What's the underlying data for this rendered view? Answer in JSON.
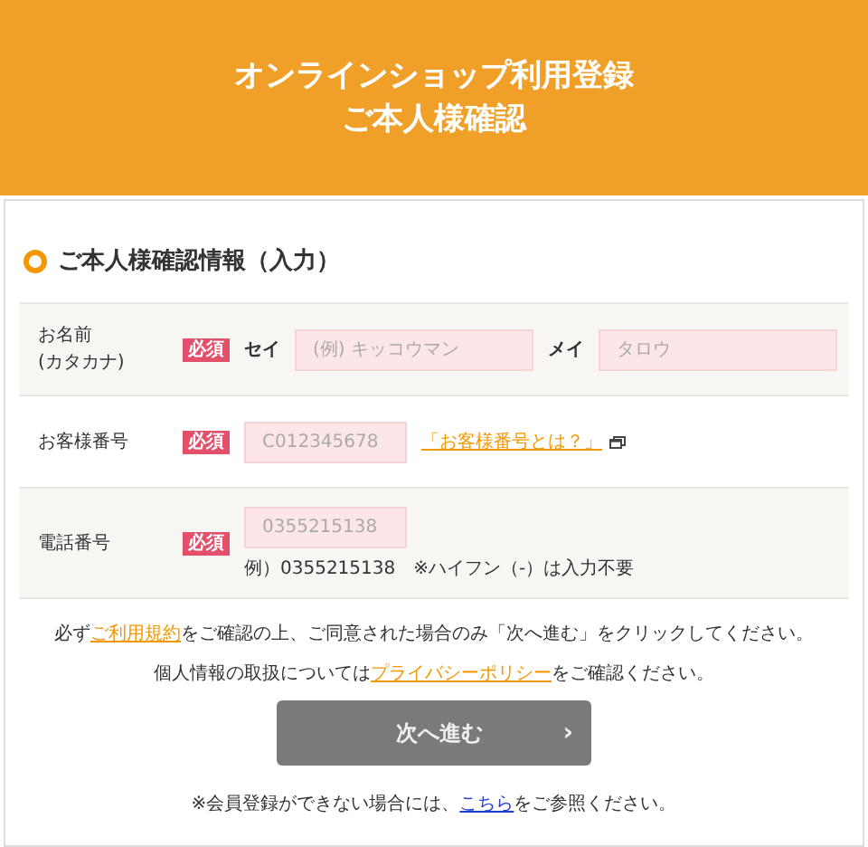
{
  "header": {
    "title_lines": [
      "オンラインショップ利用登録",
      "ご本人様確認"
    ]
  },
  "section": {
    "title": "ご本人様確認情報（入力）"
  },
  "rows": [
    {
      "label_lines": [
        "お名前",
        "(カタカナ)"
      ],
      "required": "必須",
      "kind": "name",
      "fields": [
        {
          "label": "セイ",
          "placeholder": "(例) キッコウマン"
        },
        {
          "label": "メイ",
          "placeholder": "タロウ"
        }
      ]
    },
    {
      "label_lines": [
        "お客様番号"
      ],
      "required": "必須",
      "kind": "link",
      "fields": [
        {
          "placeholder": "C012345678"
        }
      ],
      "link": "「お客様番号とは？」"
    },
    {
      "label_lines": [
        "電話番号"
      ],
      "required": "必須",
      "kind": "note",
      "fields": [
        {
          "placeholder": "0355215138"
        }
      ],
      "note": "例）0355215138　※ハイフン（-）は入力不要"
    }
  ],
  "notes": [
    {
      "before": "必ず",
      "link": "ご利用規約",
      "after": "をご確認の上、ご同意された場合のみ「次へ進む」をクリックしてください。"
    },
    {
      "before": "個人情報の取扱については",
      "link": "プライバシーポリシー",
      "after": "をご確認ください。"
    }
  ],
  "next_button": {
    "label": "次へ進む",
    "arrow": "›",
    "disabled": true
  },
  "footer": {
    "before": "※会員登録ができない場合には、",
    "link": "こちら",
    "after": "をご参照ください。"
  }
}
